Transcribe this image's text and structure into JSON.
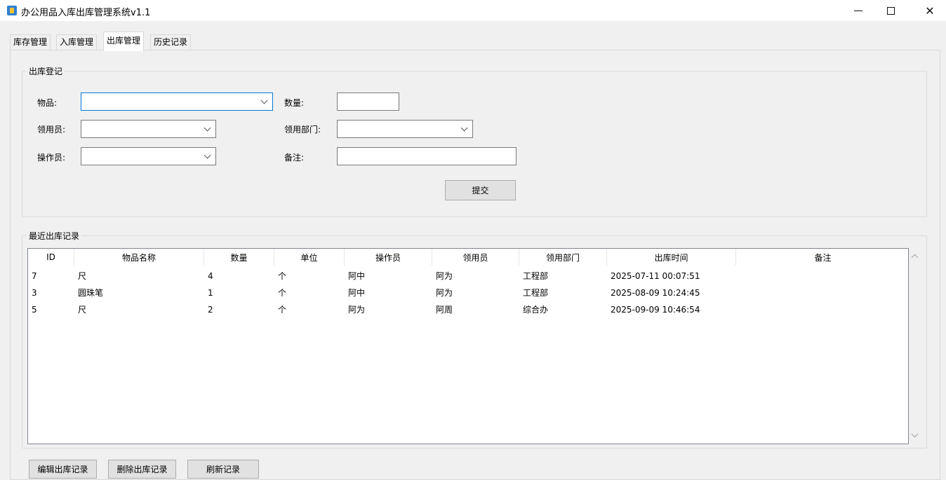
{
  "window": {
    "title": "办公用品入库出库管理系统v1.1",
    "icon": "app-icon",
    "minimize_icon": "minimize-icon",
    "maximize_icon": "maximize-icon",
    "close_icon": "close-icon",
    "close_glyph": "✕"
  },
  "tabs": [
    {
      "label": "库存管理"
    },
    {
      "label": "入库管理"
    },
    {
      "label": "出库管理",
      "active": true
    },
    {
      "label": "历史记录"
    }
  ],
  "outbound_form": {
    "group_title": "出库登记",
    "item_label": "物品:",
    "item_value": "",
    "quantity_label": "数量:",
    "quantity_value": "",
    "recipient_label": "领用员:",
    "recipient_value": "",
    "department_label": "领用部门:",
    "department_value": "",
    "operator_label": "操作员:",
    "operator_value": "",
    "remark_label": "备注:",
    "remark_value": "",
    "submit_label": "提交"
  },
  "recent_records": {
    "group_title": "最近出库记录",
    "columns": [
      "ID",
      "物品名称",
      "数量",
      "单位",
      "操作员",
      "领用员",
      "领用部门",
      "出库时间",
      "备注"
    ],
    "rows": [
      {
        "id": "7",
        "name": "尺",
        "qty": "4",
        "unit": "个",
        "operator": "阿中",
        "recipient": "阿为",
        "department": "工程部",
        "time": "2025-07-11 00:07:51",
        "remark": ""
      },
      {
        "id": "3",
        "name": "圆珠笔",
        "qty": "1",
        "unit": "个",
        "operator": "阿中",
        "recipient": "阿为",
        "department": "工程部",
        "time": "2025-08-09 10:24:45",
        "remark": ""
      },
      {
        "id": "5",
        "name": "尺",
        "qty": "2",
        "unit": "个",
        "operator": "阿为",
        "recipient": "阿周",
        "department": "综合办",
        "time": "2025-09-09 10:46:54",
        "remark": ""
      }
    ]
  },
  "actions": {
    "edit_label": "编辑出库记录",
    "delete_label": "删除出库记录",
    "refresh_label": "刷新记录"
  },
  "colors": {
    "accent": "#0078d7",
    "window_bg": "#f0f0f0",
    "button_bg": "#e1e1e1"
  }
}
